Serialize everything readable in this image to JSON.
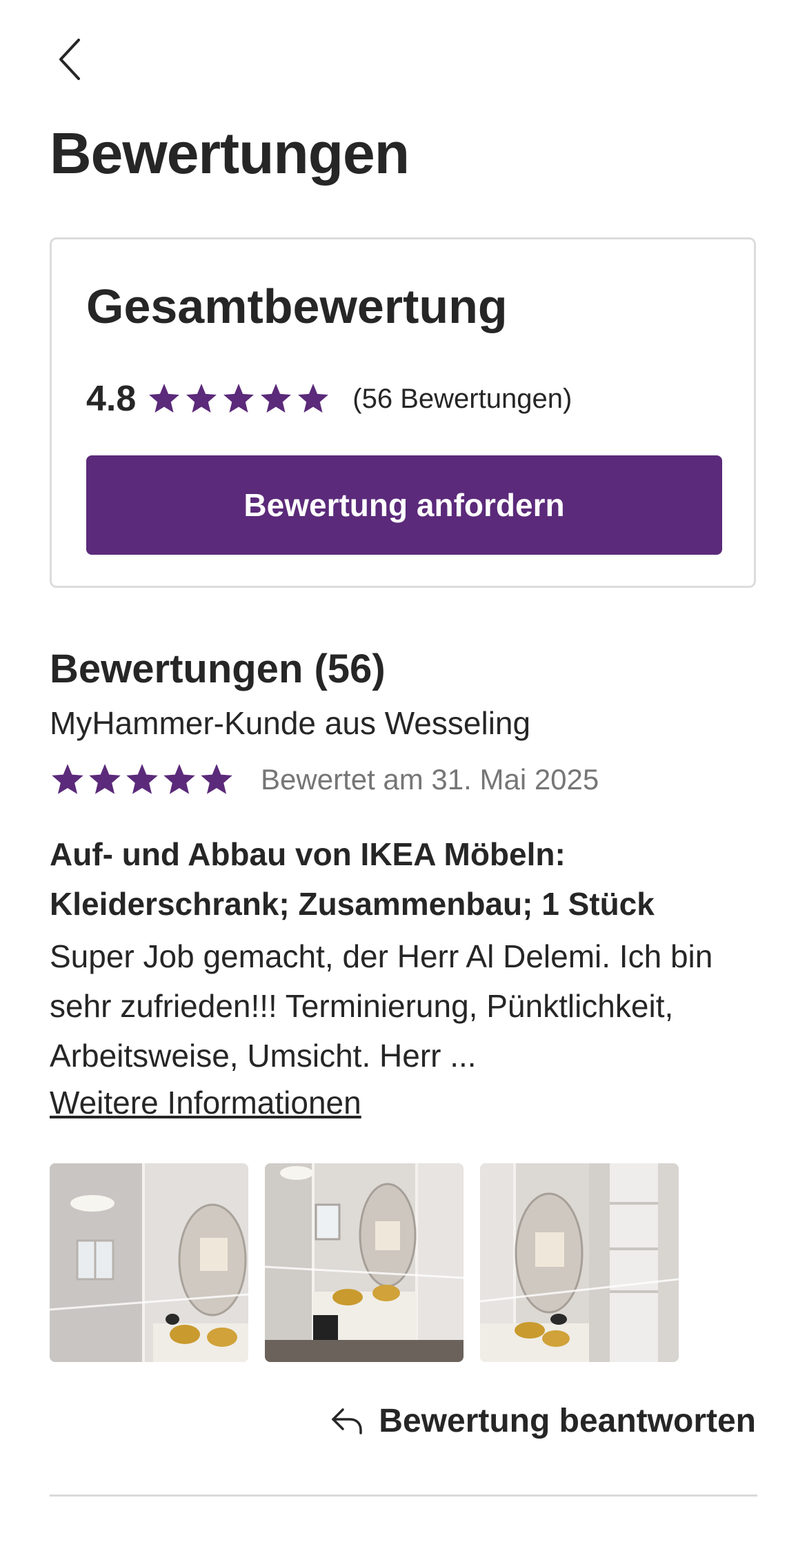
{
  "header": {
    "back_icon": "chevron-left-icon",
    "title": "Bewertungen"
  },
  "summary": {
    "title": "Gesamtbewertung",
    "rating": "4.8",
    "stars": 5,
    "count_label": "(56 Bewertungen)",
    "request_button_label": "Bewertung anfordern"
  },
  "reviews": {
    "heading": "Bewertungen (56)",
    "items": [
      {
        "reviewer": "MyHammer-Kunde aus Wesseling",
        "stars": 5,
        "date_label": "Bewertet am 31. Mai 2025",
        "headline": "Auf- und Abbau von IKEA Möbeln: Kleiderschrank; Zusammenbau; 1 Stück",
        "body": "Super Job gemacht, der Herr Al Delemi. Ich bin sehr zufrieden!!! Terminierung, Pünktlichkeit, Arbeitsweise, Umsicht. Herr ...",
        "more_label": "Weitere Informationen",
        "photo_count": 3,
        "reply_label": "Bewertung beantworten",
        "reply_icon": "reply-arrow-icon"
      }
    ]
  },
  "colors": {
    "brand_purple": "#5b2a7a",
    "star": "#5b2a7a",
    "text": "#262626",
    "muted_text": "#767676",
    "border": "#dcdcdc"
  }
}
